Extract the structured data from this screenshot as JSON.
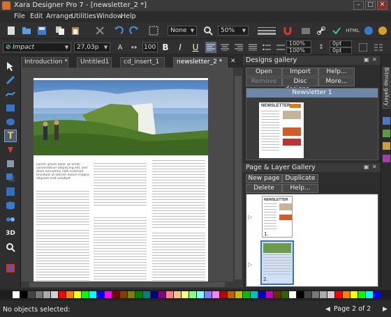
{
  "window": {
    "title": "Xara Designer Pro 7 - [newsletter_2 *]",
    "min": "–",
    "max": "□",
    "close": "✕"
  },
  "menu": [
    "File",
    "Edit",
    "Arrange",
    "Utilities",
    "Window",
    "Help"
  ],
  "toolbar": {
    "fill_mode": "None",
    "zoom": "50%",
    "html_label": "HTML"
  },
  "textbar": {
    "font": "Impact",
    "font_size": "27,03p",
    "percent": "100",
    "bold": "B",
    "italic": "I",
    "underline": "U",
    "top_a": "100%",
    "top_b": "100%",
    "spacing_a": "0pt",
    "spacing_b": "0pt"
  },
  "doc_tabs": [
    {
      "label": "Introduction *"
    },
    {
      "label": "Untitled1"
    },
    {
      "label": "cd_insert_1"
    },
    {
      "label": "newsletter_2 *"
    }
  ],
  "article": {
    "paragraphs": [
      "Lorem ipsum dolor sit amet, consectetuer adipiscing elit, sed diam nonummy nibh euismod tincidunt ut laoreet dolore magna aliquam erat volutpat."
    ]
  },
  "designs_gallery": {
    "title": "Designs gallery",
    "buttons": {
      "open": "Open",
      "import": "Import",
      "help": "Help...",
      "remove": "Remove",
      "disc": "Disc designs...",
      "more": "More..."
    },
    "item_label": "Newsletter 1",
    "thumb_title": "NEWSLETTER"
  },
  "page_layer_gallery": {
    "title": "Page & Layer Gallery",
    "buttons": {
      "new_page": "New page",
      "duplicate": "Duplicate",
      "delete": "Delete",
      "help": "Help..."
    },
    "pages": [
      {
        "label": "1."
      },
      {
        "label": "2."
      }
    ],
    "thumb_title": "NEWSLETTER"
  },
  "side_tab": "Bitmap gallery",
  "status": {
    "left": "No objects selected:",
    "page": "Page 2 of 2"
  },
  "colors": {
    "accent": "#1a5bb8",
    "orange": "#e07a1f"
  }
}
